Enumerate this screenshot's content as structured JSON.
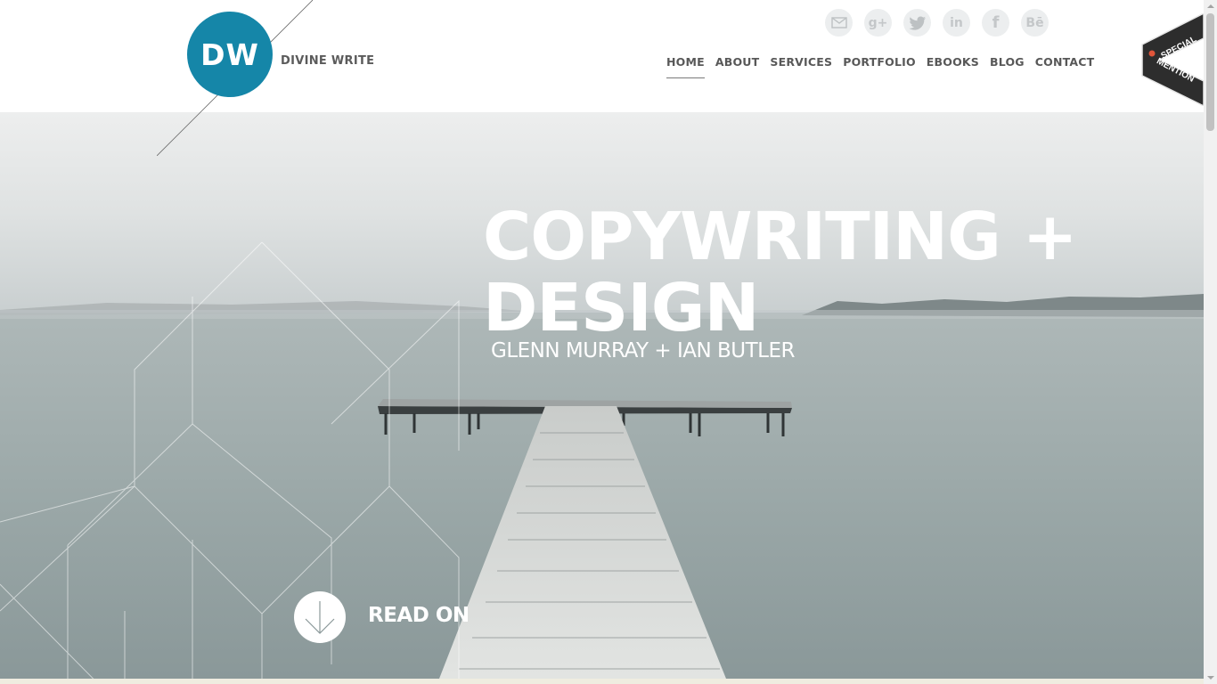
{
  "brand": {
    "initials": "DW",
    "name": "DIVINE WRITE",
    "accent_color": "#1586a8"
  },
  "social_icons": [
    {
      "name": "email-icon",
      "label": ""
    },
    {
      "name": "google-plus-icon",
      "label": "g+"
    },
    {
      "name": "twitter-icon",
      "label": ""
    },
    {
      "name": "linkedin-icon",
      "label": "in"
    },
    {
      "name": "facebook-icon",
      "label": "f"
    },
    {
      "name": "behance-icon",
      "label": "Bē"
    }
  ],
  "nav": {
    "items": [
      "HOME",
      "ABOUT",
      "SERVICES",
      "PORTFOLIO",
      "EBOOKS",
      "BLOG",
      "CONTACT"
    ],
    "active": "HOME"
  },
  "ribbon": {
    "line1": "SPECIAL",
    "line2": "MENTION"
  },
  "hero": {
    "title_line1": "COPYWRITING +",
    "title_line2": "DESIGN",
    "subtitle": "GLENN MURRAY + IAN BUTLER",
    "cta_label": "READ ON"
  }
}
